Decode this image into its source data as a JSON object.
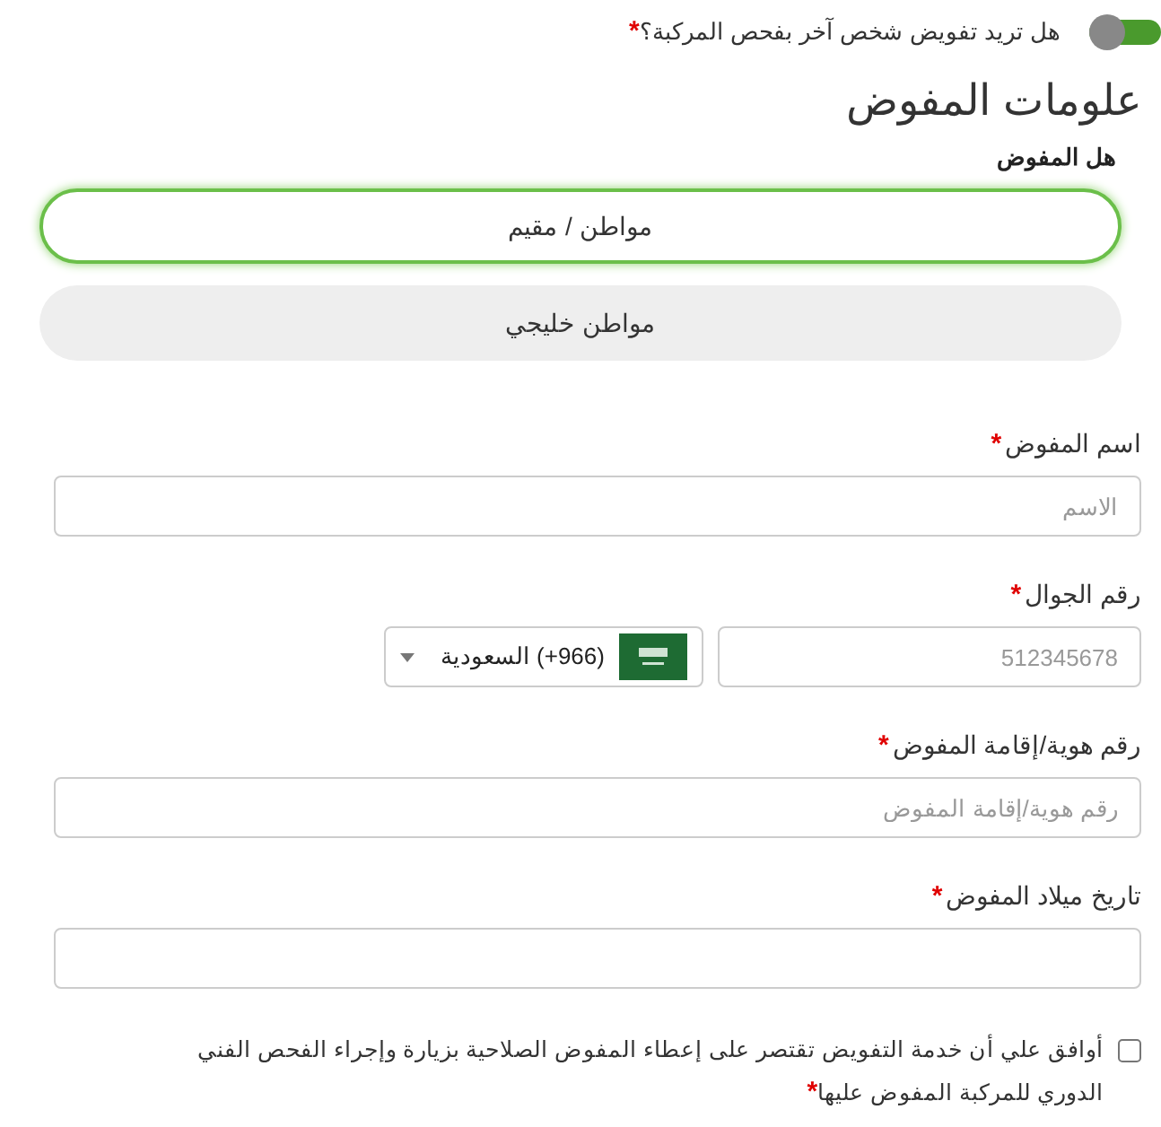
{
  "delegate_toggle": {
    "label": "هل تريد تفويض شخص آخر بفحص المركبة؟",
    "required_mark": "*",
    "on": true
  },
  "section_title": "علومات المفوض",
  "delegate_type": {
    "label": "هل المفوض",
    "options": [
      {
        "label": "مواطن / مقيم",
        "selected": true
      },
      {
        "label": "مواطن خليجي",
        "selected": false
      }
    ]
  },
  "fields": [
    {
      "kind": "text",
      "label": "اسم المفوض",
      "required_mark": "*",
      "placeholder": "الاسم"
    },
    {
      "kind": "phone",
      "label": "رقم الجوال",
      "required_mark": "*",
      "placeholder": "512345678",
      "country": "(966+) السعودية"
    },
    {
      "kind": "text",
      "label": "رقم هوية/إقامة المفوض",
      "required_mark": "*",
      "placeholder": "رقم هوية/إقامة المفوض"
    },
    {
      "kind": "text",
      "label": "تاريخ ميلاد المفوض",
      "required_mark": "*"
    }
  ],
  "agreement": {
    "text": "أوافق علي أن خدمة التفويض تقتصر على إعطاء المفوض الصلاحية بزيارة وإجراء الفحص الفني الدوري للمركبة المفوض عليها",
    "required_mark": "*",
    "checked": false
  }
}
